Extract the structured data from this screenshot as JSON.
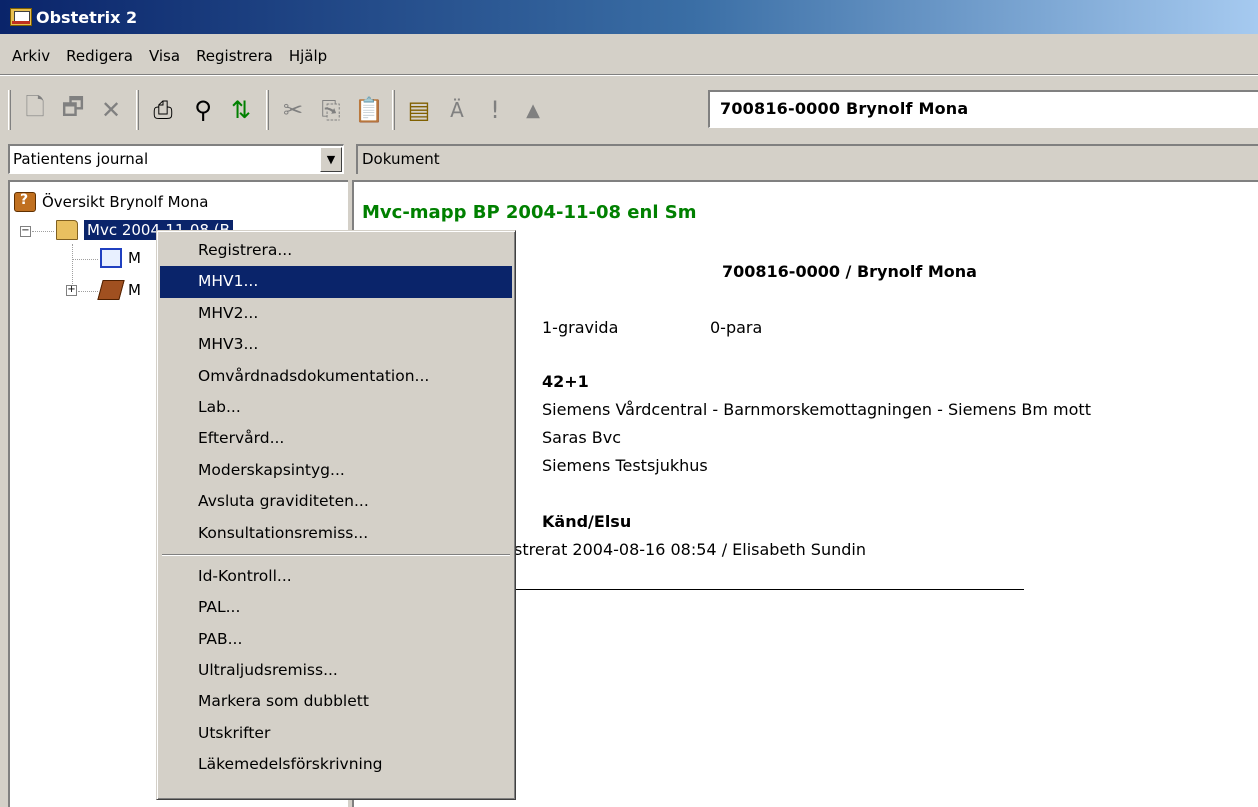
{
  "window": {
    "title": "Obstetrix 2"
  },
  "menubar": {
    "items": [
      "Arkiv",
      "Redigera",
      "Visa",
      "Registrera",
      "Hjälp"
    ]
  },
  "toolbar": {
    "buttons": [
      {
        "icon": "new-document-icon",
        "glyph": "🗋",
        "enabled": false
      },
      {
        "icon": "properties-icon",
        "glyph": "🗗",
        "enabled": false
      },
      {
        "icon": "delete-icon",
        "glyph": "✕",
        "enabled": false
      },
      {
        "icon": "print-icon",
        "glyph": "⎙",
        "enabled": true
      },
      {
        "icon": "find-icon",
        "glyph": "⚲",
        "enabled": true
      },
      {
        "icon": "refresh-icon",
        "glyph": "⇅",
        "enabled": true
      },
      {
        "icon": "cut-icon",
        "glyph": "✂",
        "enabled": false
      },
      {
        "icon": "copy-icon",
        "glyph": "⎘",
        "enabled": false
      },
      {
        "icon": "paste-icon",
        "glyph": "📋",
        "enabled": false
      },
      {
        "icon": "clipboard-icon",
        "glyph": "▤",
        "enabled": true
      },
      {
        "icon": "a-umlaut-icon",
        "glyph": "Ä",
        "enabled": false
      },
      {
        "icon": "warning-icon",
        "glyph": "!",
        "enabled": false
      },
      {
        "icon": "eject-icon",
        "glyph": "▲",
        "enabled": false
      }
    ],
    "patient": "700816-0000 Brynolf Mona"
  },
  "nav": {
    "combo_value": "Patientens journal",
    "doc_header": "Dokument"
  },
  "tree": {
    "overview": "Översikt Brynolf Mona",
    "mvc_visible": "Mvc 2004-11-08 (B",
    "child1": "M",
    "child2": "M"
  },
  "context_menu": {
    "group1": [
      "Registrera...",
      "MHV1...",
      "MHV2...",
      "MHV3...",
      "Omvårdnadsdokumentation...",
      "Lab...",
      "Eftervård...",
      "Moderskapsintyg...",
      "Avsluta graviditeten...",
      "Konsultationsremiss..."
    ],
    "group2": [
      "Id-Kontroll...",
      "PAL...",
      "PAB...",
      "Ultraljudsremiss...",
      "Markera som dubblett",
      "Utskrifter",
      "Läkemedelsförskrivning"
    ],
    "highlighted": "MHV1..."
  },
  "document": {
    "title": "Mvc-mapp BP 2004-11-08 enl Sm",
    "patient_line": "700816-0000 / Brynolf Mona",
    "gravida": "1-gravida",
    "para": "0-para",
    "weeks": "42+1",
    "place1": "Siemens Vårdcentral - Barnmorskemottagningen - Siemens Bm mott",
    "place2": "Saras Bvc",
    "place3": "Siemens Testsjukhus",
    "known": "Känd/Elsu",
    "registered": "strerat 2004-08-16 08:54 / Elisabeth Sundin"
  }
}
